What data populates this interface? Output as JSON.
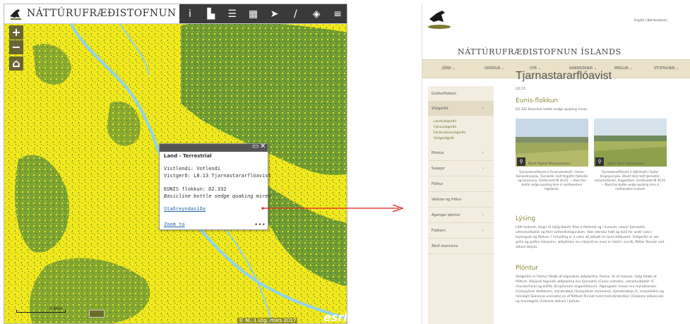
{
  "map": {
    "title": "NÁTTÚRUFRÆÐISTOFNUN ÍSLANDS",
    "tools": [
      {
        "icon": "info-icon",
        "glyph": "i"
      },
      {
        "icon": "bookmark-icon",
        "glyph": "▙"
      },
      {
        "icon": "list-icon",
        "glyph": "☰"
      },
      {
        "icon": "grid-icon",
        "glyph": "▦"
      },
      {
        "icon": "pointer-icon",
        "glyph": "➤"
      },
      {
        "icon": "draw-icon",
        "glyph": "/"
      },
      {
        "icon": "layers-icon",
        "glyph": "◈"
      },
      {
        "icon": "menu-icon",
        "glyph": "≡"
      }
    ],
    "zoom_in": "+",
    "zoom_out": "−",
    "home_glyph": "⌂",
    "popup": {
      "title": "Land - Terrestrial",
      "line1": "Vistlendi: Votlendi",
      "line2": "Vistgerð: L8.13 Tjarnastararflóavist",
      "line3": "EUNIS flokkun: D2.332",
      "line4": "Basicline bottle sedge quaking mires",
      "link": "Staðreyndasíða",
      "zoom": "Zoom to",
      "more": "•••",
      "close": "✕",
      "maximize": "▭"
    },
    "scale": "0.6km",
    "attribution": "© NÍ, 1.útg. mars 2017",
    "esri": "esri",
    "colors": {
      "yellow": "#f4ea1c",
      "green": "#6e9a34",
      "dark_green": "#3d6b2a",
      "river": "#8fd3ee"
    }
  },
  "site": {
    "title": "NÁTTÚRUFRÆÐISTOFNUN ÍSLANDS",
    "top_right": "English  |  Nát.facebook  |",
    "nav": [
      "JÖRÐ ⌄",
      "GRÓÐUR ⌄",
      "DÝR ⌄",
      "RANNSÓKNIR ⌄",
      "MIÐLUN ⌄",
      "STOFNUNIN ⌄"
    ],
    "sidebar": [
      {
        "label": "Gróðurflokkun",
        "chev": ""
      },
      {
        "label": "Vistgerðir",
        "chev": "›"
      },
      {
        "label": "Plöntur",
        "chev": "›"
      },
      {
        "label": "Sveppir",
        "chev": "›"
      },
      {
        "label": "Fléttur",
        "chev": ""
      },
      {
        "label": "Válistar og friðun",
        "chev": ""
      },
      {
        "label": "Ágengar plöntur",
        "chev": "›"
      },
      {
        "label": "Frjókorn",
        "chev": "›"
      },
      {
        "label": "Ábrif mannsins",
        "chev": ""
      }
    ],
    "sub_items": [
      "Landvistgerðir",
      "Fjöruvistgerðir",
      "Ferskvatnsvistgerðir",
      "Vistgerðgrölt"
    ],
    "page_title": "Tjarnastararflóavist",
    "code": "L8.13",
    "eunis_heading": "Eunis-flokkun",
    "eunis_text": "D2.332 Basicline bottle sedge quaking mires.",
    "photo1_credit": "Mynd: Sigmar Metúsalemsson",
    "photo2_credit": "Mynd: Starri Heiðmarsson",
    "caption1": "Tjarnastararflóavist á Árnarvatnsheiði í Vestur-Húnavatnssýslu. Tjarnastör með fergjóttri fjallastör og hararunnu. Greiðsvaett NÍ 40.03. — Basicline bottle sedge quaking mire in northwestern highlands.",
    "caption2": "Tjarnastararflóavist á Hjöltsheiði í Suður-Þingeyjarsýslu. Blautt land með tjarnastör, vetrarkvíðastör, fergjutófum. Greiðsvaett NÍ 40.03. — Basicline bottle sedge quaking mire in northeastern Iceland.",
    "lysing_heading": "Lýsing",
    "lysing_text": "Lítið hallandi, deigir til mjög blautir flóar á flatlendi og í kvosum, vaxnir tjarnastör, vetrarkvíðastör og fleiri votlendistegundum. Vatn stendur hátt og land fer undir vatn í leysingum og flóðum. Í hrinylfing er á vatni að jafnaði en land alltöjsamt. Vistgerðin er vel gróin og gróður hávaxinn, æðplöntur eru ríkjandi en mosi er mikill í sverði, fléttur finnast vart sökum bleytu.",
    "plontur_heading": "Plöntur",
    "plontur_text": "Vistgerðin er fremur fátæk af tegundum æðplantna, fremur rík af mosum, mjög fátæk af fléttum. Ríkjandi tegundir æðplantna eru tjarnastör (Carex rostrata), vetrarkvíðastör (C. chordorrhiza) og klófífa (Eriophorum angustifolium). Algengastir mosar eru mýrabrandur (Campylium stellatum), mýrakrækja (Scorpidium revolvens), tjarnakrækja (S. scorpioides) og mósalgð (Sanionia uncinata) en af fléttum finnast helst hreindýrakrókar (Cladonia arbuscula) og mundagrös (Cetraria delisei) í þúfum."
  }
}
